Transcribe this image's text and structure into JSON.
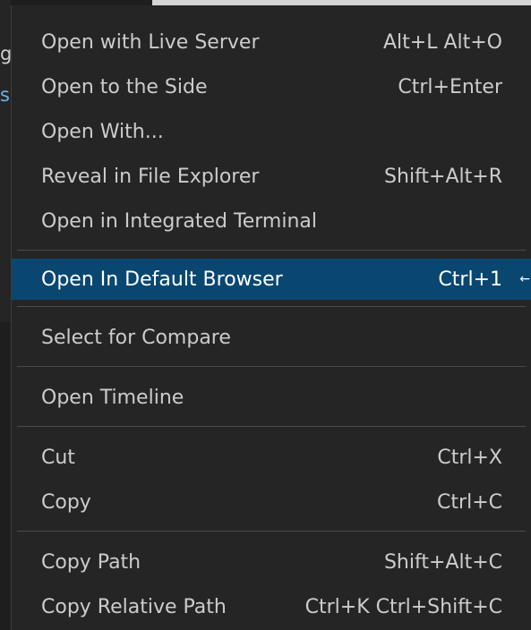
{
  "menu": {
    "groups": [
      {
        "items": [
          {
            "label": "Open with Live Server",
            "key": "Alt+L Alt+O"
          },
          {
            "label": "Open to the Side",
            "key": "Ctrl+Enter"
          },
          {
            "label": "Open With...",
            "key": ""
          },
          {
            "label": "Reveal in File Explorer",
            "key": "Shift+Alt+R"
          },
          {
            "label": "Open in Integrated Terminal",
            "key": ""
          }
        ]
      },
      {
        "items": [
          {
            "label": "Open In Default Browser",
            "key": "Ctrl+1"
          }
        ]
      },
      {
        "items": [
          {
            "label": "Select for Compare",
            "key": ""
          }
        ]
      },
      {
        "items": [
          {
            "label": "Open Timeline",
            "key": ""
          }
        ]
      },
      {
        "items": [
          {
            "label": "Cut",
            "key": "Ctrl+X"
          },
          {
            "label": "Copy",
            "key": "Ctrl+C"
          }
        ]
      },
      {
        "items": [
          {
            "label": "Copy Path",
            "key": "Shift+Alt+C"
          },
          {
            "label": "Copy Relative Path",
            "key": "Ctrl+K Ctrl+Shift+C"
          }
        ]
      }
    ]
  },
  "background": {
    "glyph_1": "g",
    "glyph_2": "s"
  },
  "colors": {
    "menu_bg": "#252526",
    "selected_bg": "#094771",
    "text": "#cccccc",
    "separator": "#4a4a4a"
  }
}
